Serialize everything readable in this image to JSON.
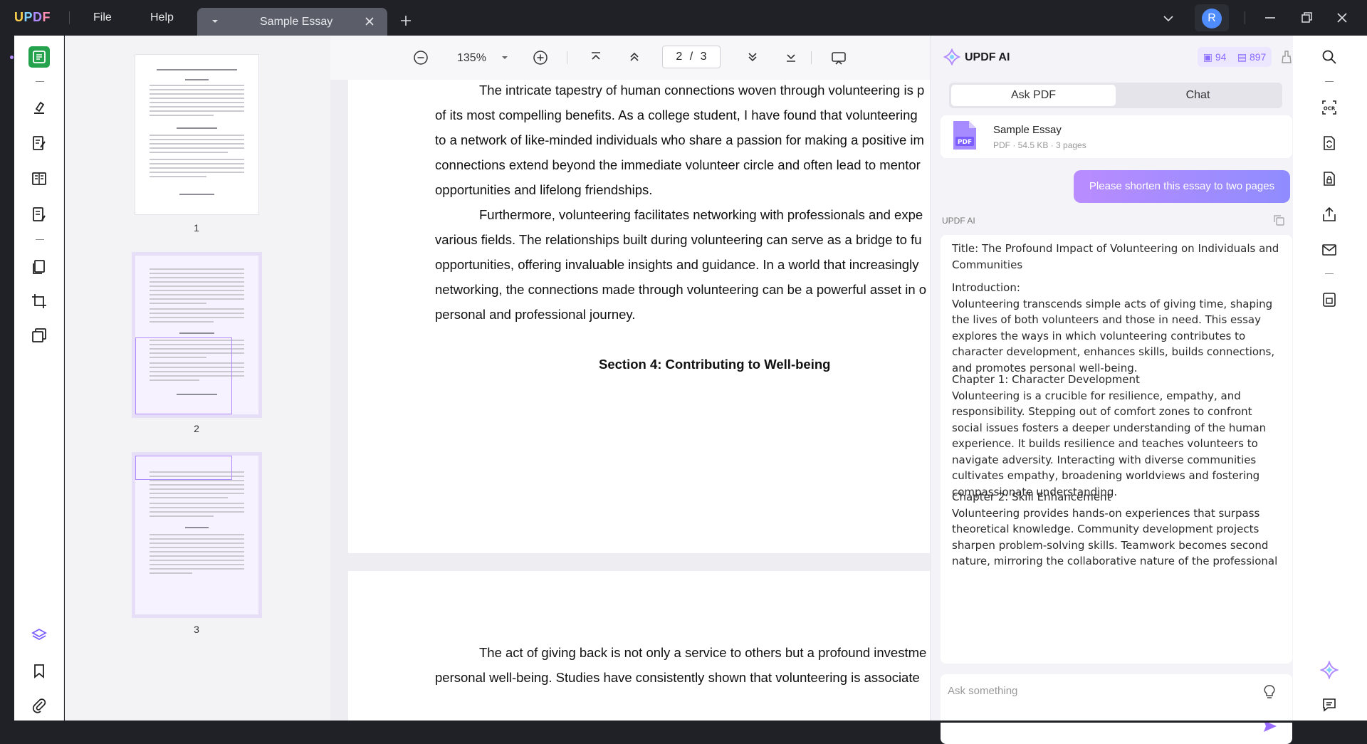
{
  "app": {
    "logo": "UPDF",
    "menu": [
      "File",
      "Help"
    ],
    "tab_title": "Sample Essay",
    "avatar_letter": "R"
  },
  "viewer": {
    "zoom": "135%",
    "current_page": "2",
    "page_sep": "/",
    "total_pages": "3"
  },
  "thumbnails": [
    {
      "page": "1"
    },
    {
      "page": "2"
    },
    {
      "page": "3"
    }
  ],
  "document": {
    "page1_lines": [
      "The intricate tapestry of human connections woven through volunteering is p",
      "of its most compelling benefits. As a college student, I have found that volunteering",
      "to a network of like-minded individuals who share a passion for making a positive im",
      "connections extend beyond the immediate volunteer circle and often lead to mentor",
      "opportunities and lifelong friendships.",
      "Furthermore, volunteering facilitates networking with professionals and expe",
      "various fields. The relationships built during volunteering can serve as a bridge to fu",
      "opportunities, offering invaluable insights and guidance. In a world that increasingly",
      "networking, the connections made through volunteering can be a powerful asset in o",
      "personal and professional journey."
    ],
    "section_heading": "Section 4: Contributing to Well-being",
    "page2_lines": [
      "The act of giving back is not only a service to others but a profound investme",
      "personal well-being. Studies have consistently shown that volunteering is associate"
    ]
  },
  "ai": {
    "title": "UPDF AI",
    "credits_a": "94",
    "credits_b": "897",
    "tabs": [
      "Ask PDF",
      "Chat"
    ],
    "file_name": "Sample Essay",
    "file_meta": "PDF · 54.5 KB · 3 pages",
    "user_message": "Please shorten this essay to two pages",
    "assistant_label": "UPDF AI",
    "answer_paragraphs": [
      "Title: The Profound Impact of Volunteering on Individuals and Communities",
      "Introduction:\nVolunteering transcends simple acts of giving time, shaping the lives of both volunteers and those in need. This essay explores the ways in which volunteering contributes to character development, enhances skills, builds connections, and promotes personal well-being.",
      "Chapter 1: Character Development\nVolunteering is a crucible for resilience, empathy, and responsibility. Stepping out of comfort zones to confront social issues fosters a deeper understanding of the human experience. It builds resilience and teaches volunteers to navigate adversity. Interacting with diverse communities cultivates empathy, broadening worldviews and fostering compassionate understanding.",
      "Chapter 2: Skill Enhancement\nVolunteering provides hands-on experiences that surpass theoretical knowledge. Community development projects sharpen problem-solving skills. Teamwork becomes second nature, mirroring the collaborative nature of the professional"
    ],
    "input_placeholder": "Ask something"
  },
  "colors": {
    "accent": "#8a6bff",
    "active_tool": "#25a34c",
    "titlebar": "#1f2127"
  }
}
